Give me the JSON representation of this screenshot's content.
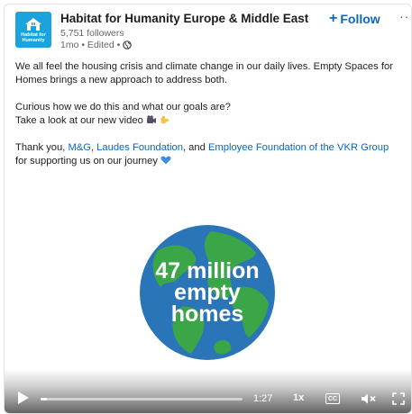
{
  "header": {
    "org_name": "Habitat for Humanity Europe & Middle East",
    "followers": "5,751 followers",
    "meta": "1mo • Edited •",
    "logo_text": "Habitat for Humanity",
    "follow_plus": "+",
    "follow_label": "Follow",
    "more_label": "···"
  },
  "post": {
    "para1": "We all feel the housing crisis and climate change in our daily lives. Empty Spaces for Homes brings a new approach to address both.",
    "para2_line1": "Curious how we do this and what our goals are?",
    "para2_line2": "Take a look at our new video",
    "para3_prefix": "Thank you, ",
    "link1": "M&G",
    "comma1": ", ",
    "link2": "Laudes Foundation",
    "and_text": ", and ",
    "link3": "Employee Foundation of the VKR Group",
    "para3_suffix": " for supporting us on our journey"
  },
  "video": {
    "overlay_line1": "47 million",
    "overlay_line2": "empty",
    "overlay_line3": "homes",
    "time": "1:27",
    "speed": "1x",
    "cc": "CC",
    "progress": 0.03,
    "ocean_color": "#2a74b8",
    "land_color": "#3aa648"
  },
  "icons": {
    "globe": "globe-icon",
    "play": "play-icon",
    "captions": "captions-icon",
    "volume": "volume-muted-icon",
    "fullscreen": "fullscreen-icon"
  }
}
